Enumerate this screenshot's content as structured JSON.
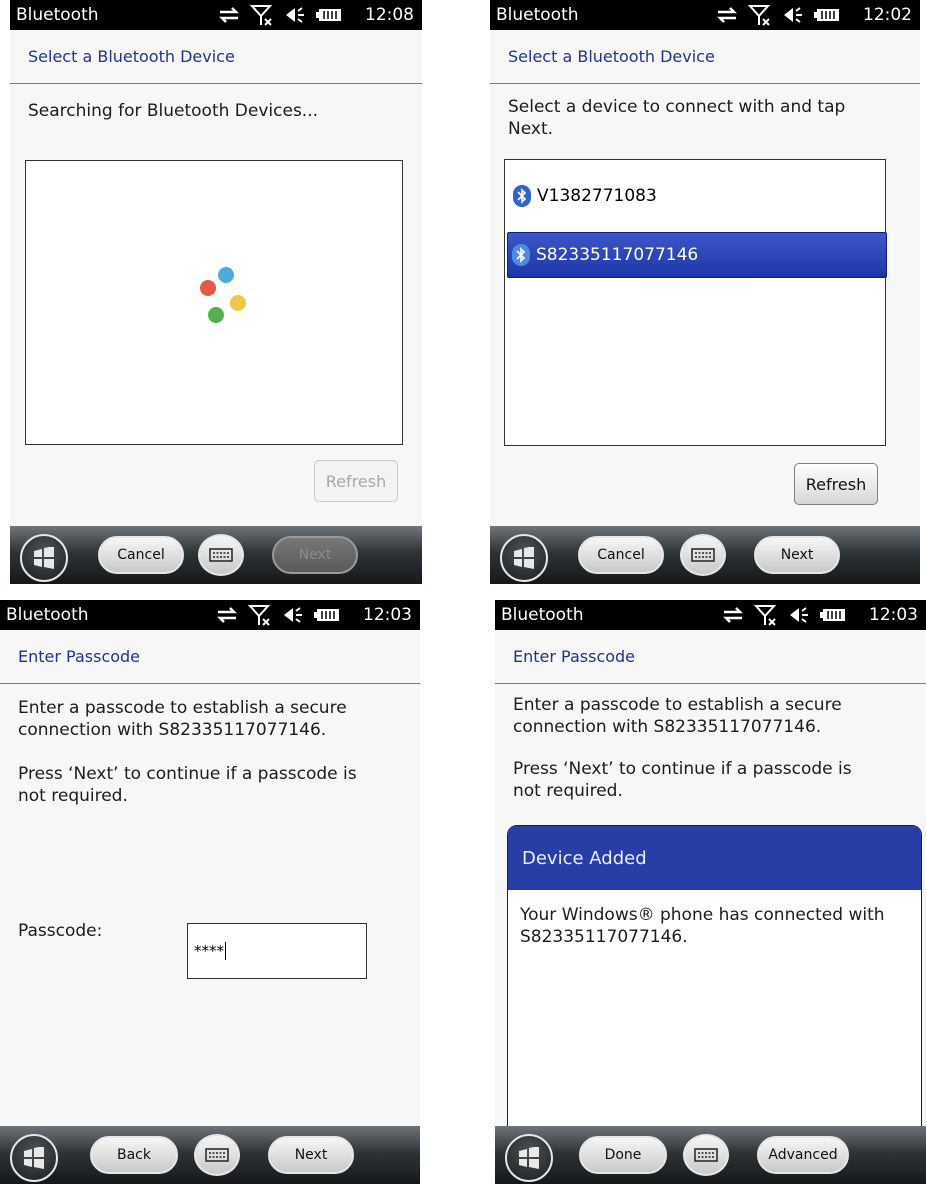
{
  "screens": [
    {
      "status": {
        "app": "Bluetooth",
        "time": "12:08"
      },
      "subtitle": "Select a Bluetooth Device",
      "message": "Searching for Bluetooth Devices...",
      "refresh_label": "Refresh",
      "bottom": {
        "left_label": "Cancel",
        "right_label": "Next"
      }
    },
    {
      "status": {
        "app": "Bluetooth",
        "time": "12:02"
      },
      "subtitle": "Select a Bluetooth Device",
      "message": "Select a device to connect with and tap Next.",
      "devices": [
        "V1382771083",
        "S82335117077146"
      ],
      "refresh_label": "Refresh",
      "bottom": {
        "left_label": "Cancel",
        "right_label": "Next"
      }
    },
    {
      "status": {
        "app": "Bluetooth",
        "time": "12:03"
      },
      "subtitle": "Enter Passcode",
      "message": "Enter a passcode to establish a secure connection with S82335117077146.",
      "message2": "Press ‘Next’ to continue if a passcode is not required.",
      "passcode_label": "Passcode:",
      "passcode_value": "****",
      "bottom": {
        "left_label": "Back",
        "right_label": "Next"
      }
    },
    {
      "status": {
        "app": "Bluetooth",
        "time": "12:03"
      },
      "subtitle": "Enter Passcode",
      "message": "Enter a passcode to establish a secure connection with S82335117077146.",
      "message2": "Press ‘Next’ to continue if a passcode is not required.",
      "dialog": {
        "title": "Device Added",
        "body": "Your Windows® phone has connected with S82335117077146."
      },
      "bottom": {
        "left_label": "Done",
        "right_label": "Advanced"
      }
    }
  ],
  "icons": [
    "sync-arrows-icon",
    "signal-off-icon",
    "speaker-icon",
    "battery-icon",
    "windows-start-icon",
    "keyboard-icon",
    "bluetooth-icon",
    "loading-dots-icon"
  ],
  "colors": {
    "status_bar": "#000000",
    "subtitle_text": "#22338c",
    "selection": "#2a44b8",
    "dialog_header": "#283da6"
  }
}
